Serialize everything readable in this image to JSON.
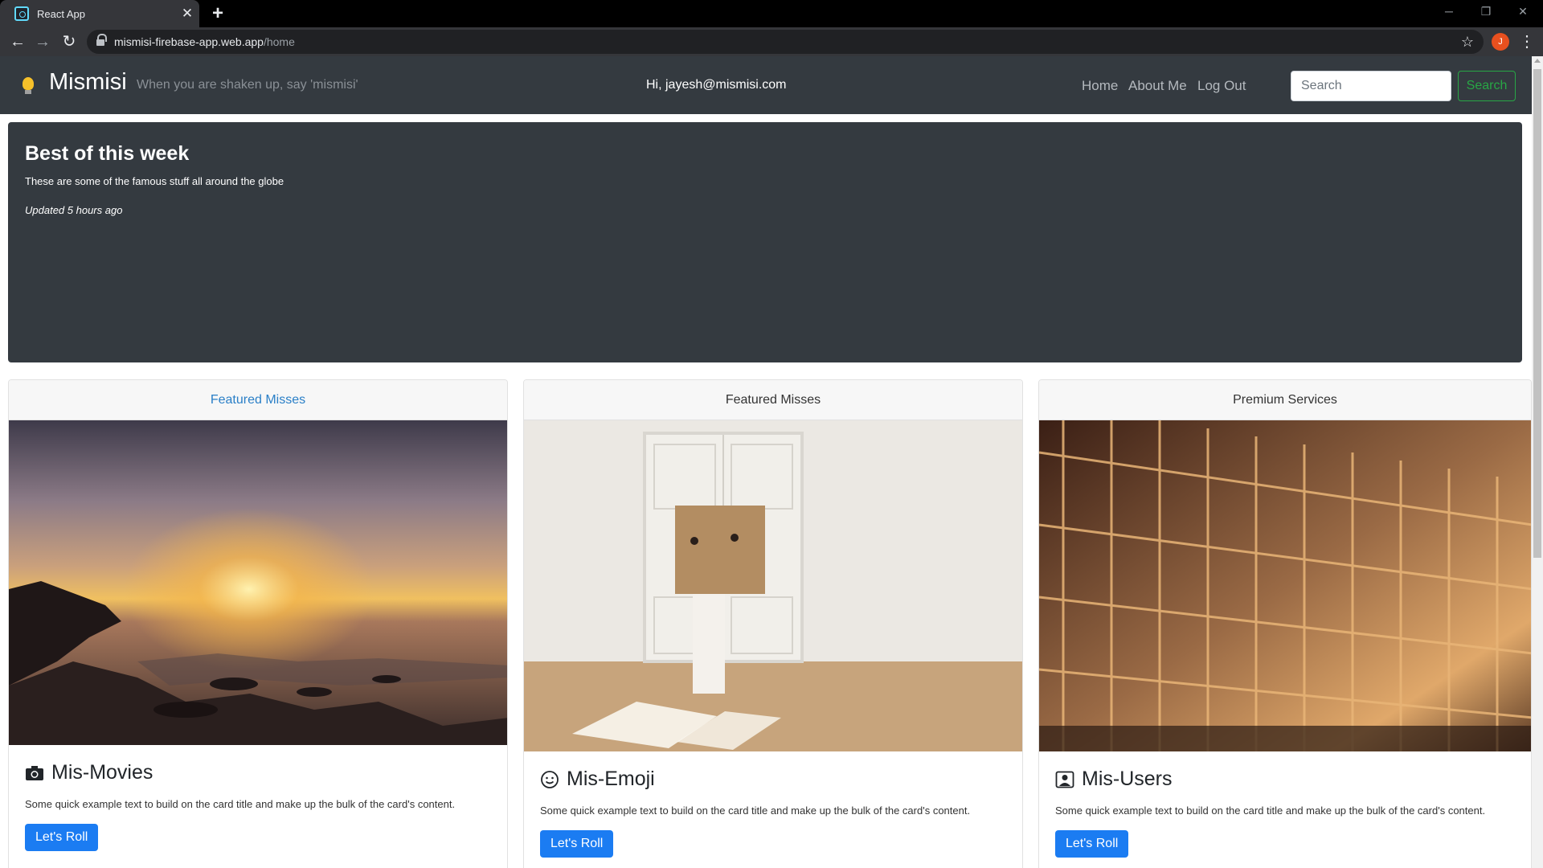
{
  "browser": {
    "tab_title": "React App",
    "tab_close": "✕",
    "new_tab": "+",
    "url_host": "mismisi-firebase-app.web.app",
    "url_path": "/home",
    "profile_initial": "J",
    "window_controls": [
      "─",
      "❐",
      "✕"
    ]
  },
  "navbar": {
    "brand": "Mismisi",
    "tagline": "When you are shaken up, say 'mismisi'",
    "greeting": "Hi, jayesh@mismisi.com",
    "links": [
      "Home",
      "About Me",
      "Log Out"
    ],
    "search_placeholder": "Search",
    "search_button": "Search",
    "search_button_color": "#28a745"
  },
  "jumbotron": {
    "title": "Best of this week",
    "subtitle": "These are some of the famous stuff all around the globe",
    "updated": "Updated 5 hours ago"
  },
  "cards": [
    {
      "header": "Featured Misses",
      "title": "Mis-Movies",
      "icon": "camera-icon",
      "text": "Some quick example text to build on the card title and make up the bulk of the card's content.",
      "button": "Let's Roll"
    },
    {
      "header": "Featured Misses",
      "title": "Mis-Emoji",
      "icon": "smiley-icon",
      "text": "Some quick example text to build on the card title and make up the bulk of the card's content.",
      "button": "Let's Roll"
    },
    {
      "header": "Premium Services",
      "title": "Mis-Users",
      "icon": "user-badge-icon",
      "text": "Some quick example text to build on the card title and make up the bulk of the card's content.",
      "button": "Let's Roll"
    }
  ],
  "colors": {
    "navbar_bg": "#343a40",
    "primary_button": "#1b7cf2",
    "link": "#2a7fc7"
  }
}
